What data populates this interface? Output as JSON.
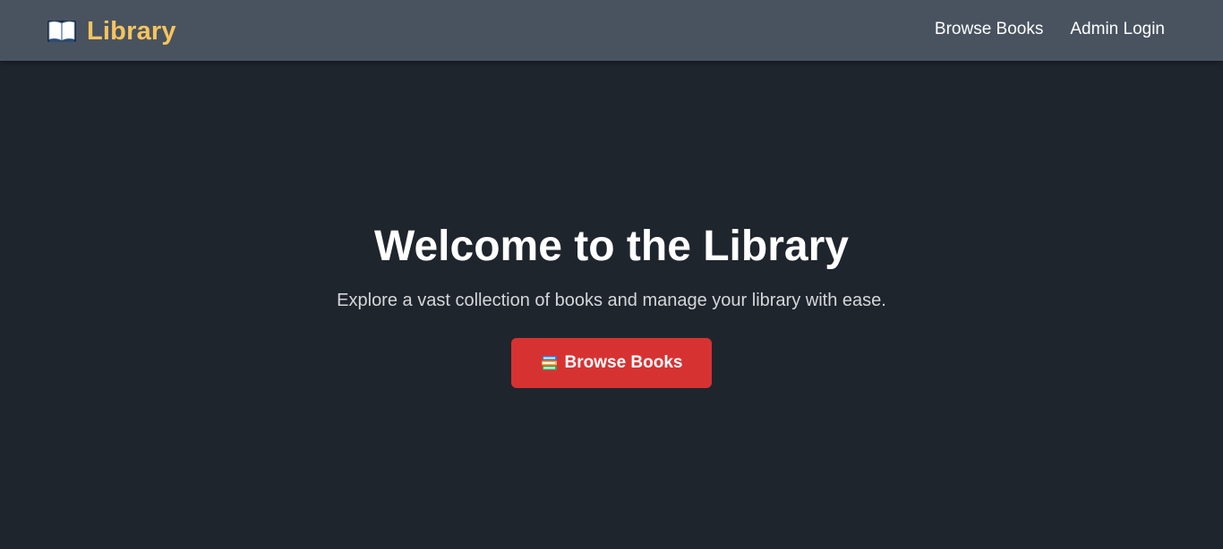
{
  "navbar": {
    "brand": {
      "icon": "open-book-icon",
      "label": "Library"
    },
    "links": [
      {
        "label": "Browse Books"
      },
      {
        "label": "Admin Login"
      }
    ]
  },
  "hero": {
    "title": "Welcome to the Library",
    "subtitle": "Explore a vast collection of books and manage your library with ease.",
    "cta": {
      "icon": "books-stack-icon",
      "label": "Browse Books"
    }
  },
  "colors": {
    "navbar_background": "#495360",
    "page_background": "#1f252d",
    "brand_accent": "#f7c45e",
    "cta_background": "#d73232",
    "text_primary": "#ffffff",
    "text_secondary": "#d4d6d9"
  }
}
